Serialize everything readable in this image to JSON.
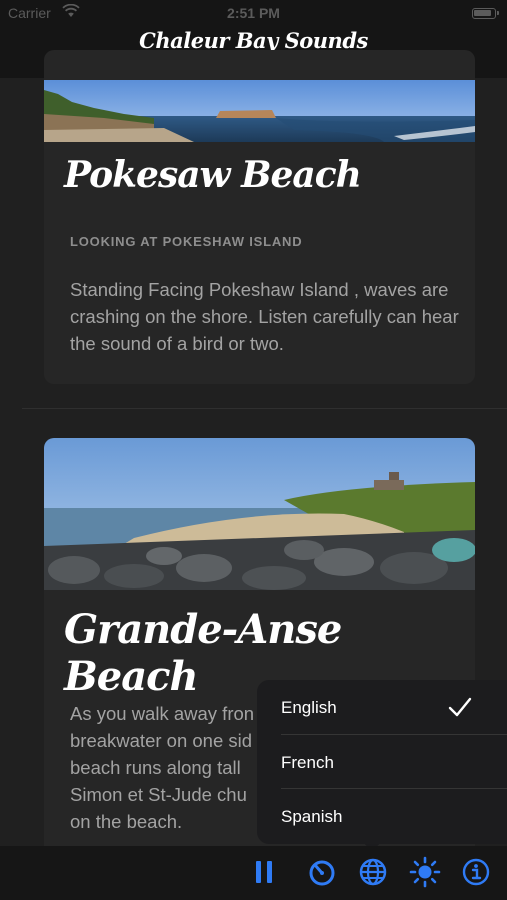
{
  "status_bar": {
    "carrier": "Carrier",
    "time": "2:51 PM"
  },
  "nav": {
    "title": "Chaleur Bay Sounds"
  },
  "cards": [
    {
      "title": "Pokesaw Beach",
      "subtitle": "LOOKING AT POKESHAW ISLAND",
      "body": "Standing Facing Pokeshaw Island , waves are crashing on the shore. Listen carefully can hear the sound of a bird or two."
    },
    {
      "title": "Grande-Anse Beach",
      "body_lines": [
        "As you walk away fron",
        "breakwater on one sid",
        "beach runs along tall",
        "Simon et St-Jude chu",
        "on the beach."
      ]
    }
  ],
  "language_menu": {
    "items": [
      {
        "label": "English",
        "selected": true
      },
      {
        "label": "French",
        "selected": false
      },
      {
        "label": "Spanish",
        "selected": false
      }
    ]
  },
  "tab_bar": {
    "accent_color": "#2f7bf5",
    "icons": [
      "pause-icon",
      "timer-icon",
      "globe-icon",
      "brightness-icon",
      "info-icon"
    ]
  }
}
